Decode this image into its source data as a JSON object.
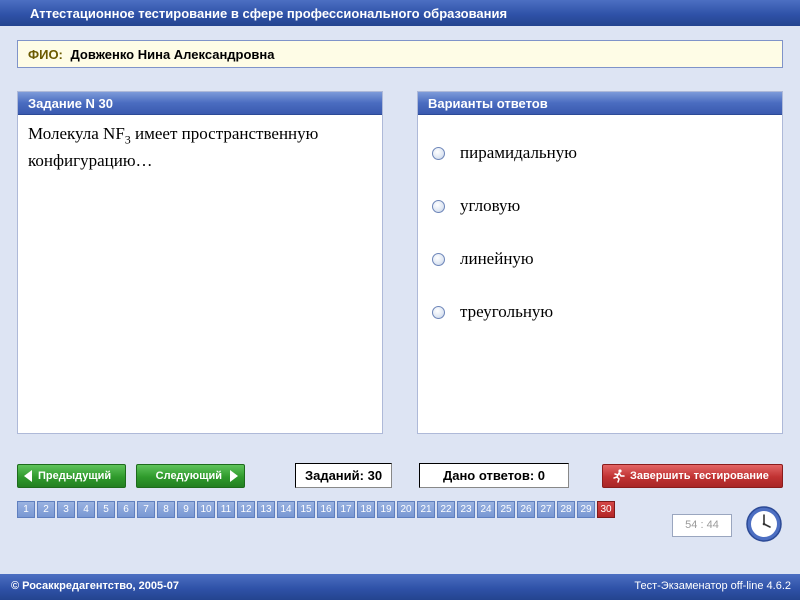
{
  "app": {
    "title": "Аттестационное тестирование в сфере профессионального образования"
  },
  "fio": {
    "label": "ФИО:",
    "name": "Довженко Нина Александровна"
  },
  "question": {
    "header": "Задание N 30",
    "text_before": "Молекула NF",
    "subscript": "3",
    "text_after": " имеет пространственную конфигурацию…"
  },
  "answers": {
    "header": "Варианты ответов",
    "options": [
      "пирамидальную",
      "угловую",
      "линейную",
      "треугольную"
    ]
  },
  "nav": {
    "prev_label": "Предыдущий",
    "next_label": "Следующий",
    "tasks_count": "Заданий: 30",
    "answered_count": "Дано ответов: 0",
    "finish_label": "Завершить тестирование"
  },
  "pages": {
    "numbers": [
      "1",
      "2",
      "3",
      "4",
      "5",
      "6",
      "7",
      "8",
      "9",
      "10",
      "11",
      "12",
      "13",
      "14",
      "15",
      "16",
      "17",
      "18",
      "19",
      "20",
      "21",
      "22",
      "23",
      "24",
      "25",
      "26",
      "27",
      "28",
      "29",
      "30"
    ],
    "current": "30"
  },
  "timer": {
    "value": "54 : 44"
  },
  "status": {
    "copyright": "© Росаккредагентство, 2005-07",
    "version": "Тест-Экзаменатор off-line 4.6.2"
  },
  "colors": {
    "title_bar": "#2f52a8",
    "panel_header": "#4a6cc0",
    "nav_button": "#2f9a2c",
    "finish_button": "#c03232",
    "page_button": "#7897d3",
    "page_active": "#b32626"
  },
  "icons": {
    "prev": "arrow-left-icon",
    "next": "arrow-right-icon",
    "finish": "runner-icon",
    "timer": "clock-icon",
    "option": "radio-icon"
  }
}
